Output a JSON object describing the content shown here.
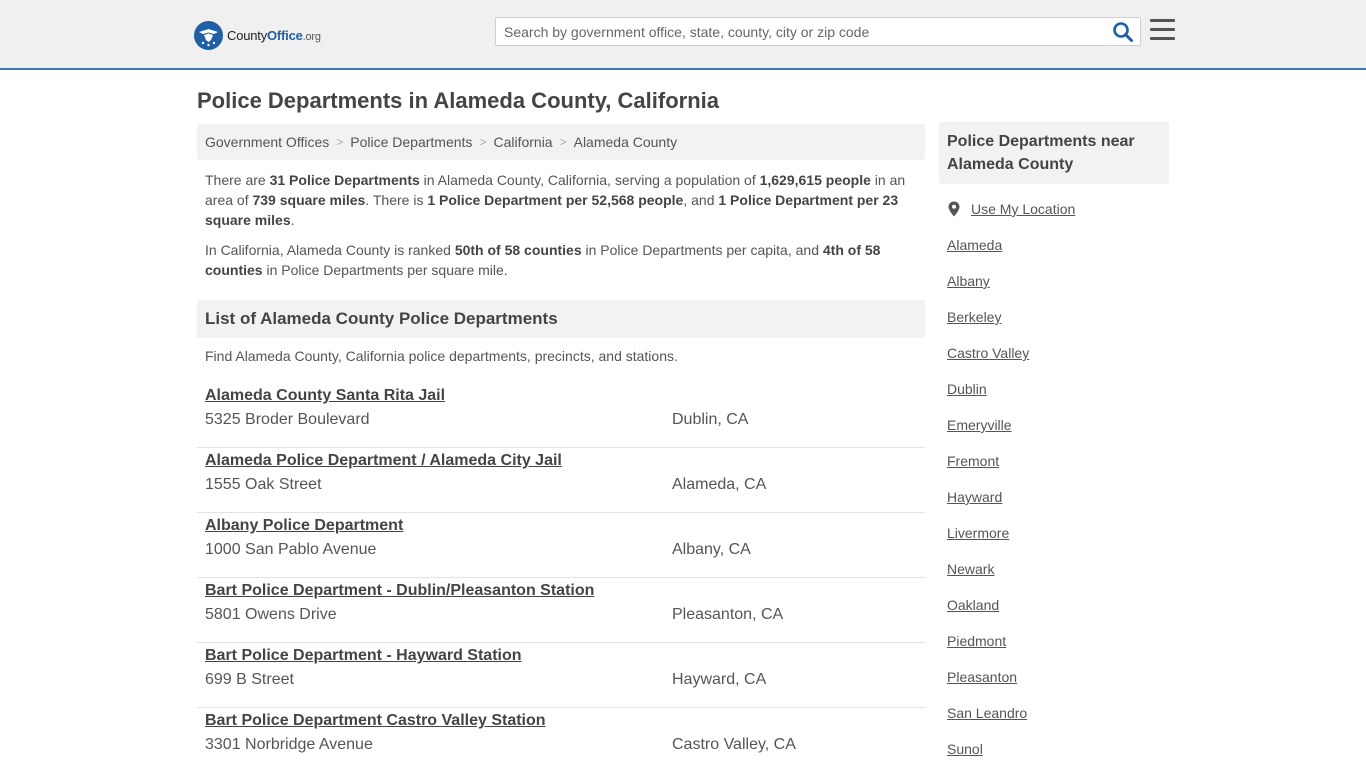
{
  "header": {
    "logo": {
      "brand_a": "County",
      "brand_b": "Office",
      "brand_tld": ".org"
    },
    "search": {
      "placeholder": "Search by government office, state, county, city or zip code",
      "value": ""
    },
    "icons": {
      "search": "search-icon",
      "menu": "hamburger-menu-icon"
    },
    "accent_color": "#3d78b8"
  },
  "page": {
    "title": "Police Departments in Alameda County, California"
  },
  "breadcrumb": [
    "Government Offices",
    "Police Departments",
    "California",
    "Alameda County"
  ],
  "intro": {
    "p1": [
      {
        "t": "There are ",
        "b": false
      },
      {
        "t": "31 Police Departments",
        "b": true
      },
      {
        "t": " in Alameda County, California, serving a population of ",
        "b": false
      },
      {
        "t": "1,629,615 people",
        "b": true
      },
      {
        "t": " in an area of ",
        "b": false
      },
      {
        "t": "739 square miles",
        "b": true
      },
      {
        "t": ". There is ",
        "b": false
      },
      {
        "t": "1 Police Department per 52,568 people",
        "b": true
      },
      {
        "t": ", and ",
        "b": false
      },
      {
        "t": "1 Police Department per 23 square miles",
        "b": true
      },
      {
        "t": ".",
        "b": false
      }
    ],
    "p2": [
      {
        "t": "In California, Alameda County is ranked ",
        "b": false
      },
      {
        "t": "50th of 58 counties",
        "b": true
      },
      {
        "t": " in Police Departments per capita, and ",
        "b": false
      },
      {
        "t": "4th of 58 counties",
        "b": true
      },
      {
        "t": " in Police Departments per square mile.",
        "b": false
      }
    ]
  },
  "list": {
    "heading": "List of Alameda County Police Departments",
    "description": "Find Alameda County, California police departments, precincts, and stations.",
    "entries": [
      {
        "name": "Alameda County Santa Rita Jail",
        "address": "5325 Broder Boulevard",
        "city": "Dublin, CA"
      },
      {
        "name": "Alameda Police Department / Alameda City Jail",
        "address": "1555 Oak Street",
        "city": "Alameda, CA"
      },
      {
        "name": "Albany Police Department",
        "address": "1000 San Pablo Avenue",
        "city": "Albany, CA"
      },
      {
        "name": "Bart Police Department - Dublin/Pleasanton Station",
        "address": "5801 Owens Drive",
        "city": "Pleasanton, CA"
      },
      {
        "name": "Bart Police Department - Hayward Station",
        "address": "699 B Street",
        "city": "Hayward, CA"
      },
      {
        "name": "Bart Police Department Castro Valley Station",
        "address": "3301 Norbridge Avenue",
        "city": "Castro Valley, CA"
      }
    ]
  },
  "sidebar": {
    "heading": "Police Departments near Alameda County",
    "use_location": "Use My Location",
    "links": [
      "Alameda",
      "Albany",
      "Berkeley",
      "Castro Valley",
      "Dublin",
      "Emeryville",
      "Fremont",
      "Hayward",
      "Livermore",
      "Newark",
      "Oakland",
      "Piedmont",
      "Pleasanton",
      "San Leandro",
      "Sunol"
    ]
  }
}
